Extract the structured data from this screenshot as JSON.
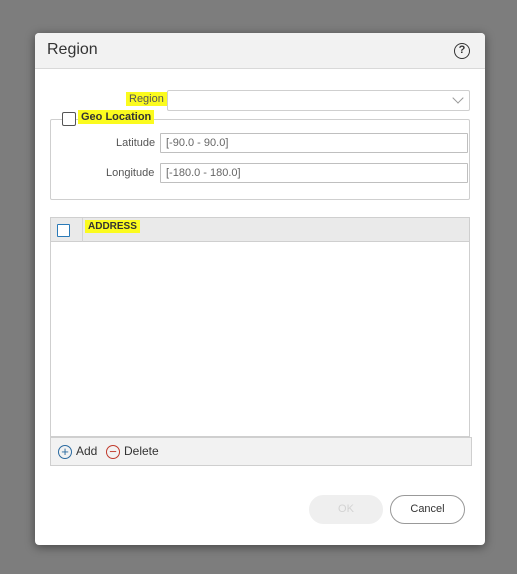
{
  "dialog": {
    "title": "Region",
    "help_icon": "?"
  },
  "form": {
    "region_label": "Region",
    "region_value": "",
    "geo_location_label": "Geo Location",
    "geo_location_checked": false,
    "latitude_label": "Latitude",
    "latitude_placeholder": "[-90.0 - 90.0]",
    "longitude_label": "Longitude",
    "longitude_placeholder": "[-180.0 - 180.0]"
  },
  "address_grid": {
    "column_header": "ADDRESS",
    "rows": []
  },
  "grid_footer": {
    "add_label": "Add",
    "add_icon": "plus-circle-icon",
    "delete_label": "Delete",
    "delete_icon": "minus-circle-icon"
  },
  "buttons": {
    "ok_label": "OK",
    "ok_enabled": false,
    "cancel_label": "Cancel"
  },
  "colors": {
    "highlight": "#fbfb1e",
    "accent_blue": "#2a7ab8",
    "delete_red": "#c0392b"
  }
}
